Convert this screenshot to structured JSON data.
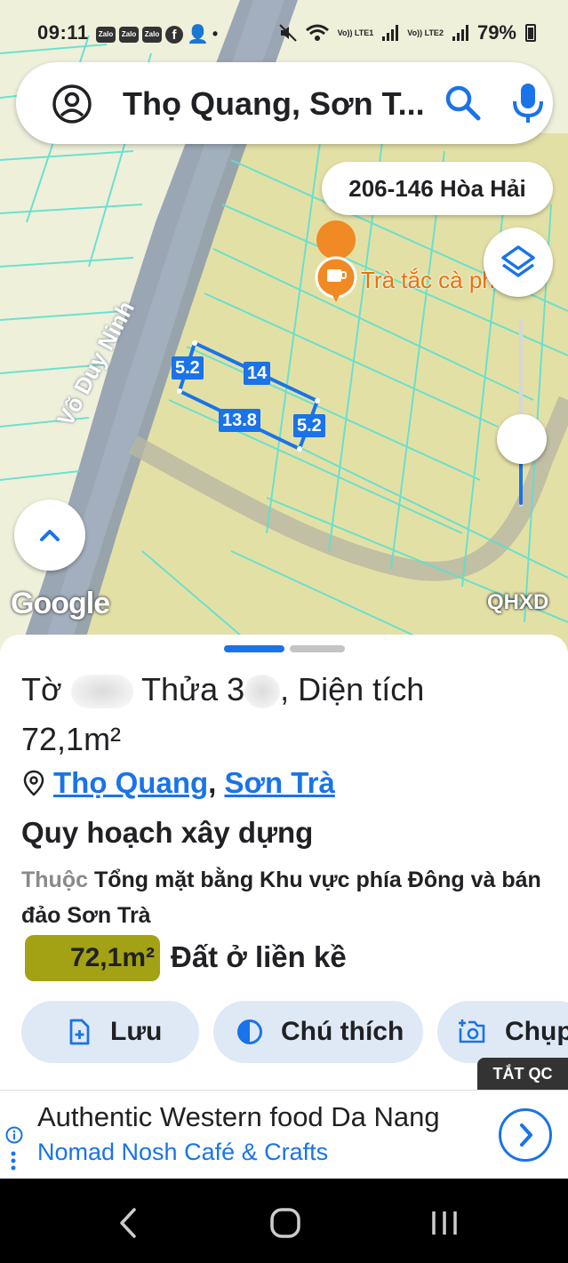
{
  "status_bar": {
    "time": "09:11",
    "notification_labels": [
      "Zalo",
      "Zalo",
      "Zalo"
    ],
    "battery": "79%",
    "sim1": "Vo)) LTE1",
    "sim2": "Vo)) LTE2"
  },
  "search": {
    "query": "Thọ Quang, Sơn T..."
  },
  "map": {
    "address_chip": "206-146 Hòa Hải",
    "poi_label": "Trà tắc cà phê oz",
    "road_label": "Võ Duy Ninh",
    "measurements": {
      "top": "14",
      "left": "5.2",
      "bottom": "13.8",
      "right": "5.2"
    },
    "logo": "Google",
    "layer_label": "QHXD",
    "opacity_level": 0.35
  },
  "sheet": {
    "title_part1": "Tờ",
    "title_part2": "Thửa 3",
    "title_part3": ", Diện tích",
    "title_area": "72,1m²",
    "location": {
      "ward": "Thọ Quang",
      "district": "Sơn Trà"
    },
    "section_heading": "Quy hoạch xây dựng",
    "plan_prefix": "Thuộc",
    "plan_name": "Tổng mặt bằng Khu vực phía Đông và bán đảo Sơn Trà",
    "area_badge": "72,1m²",
    "land_type": "Đất ở liền kề",
    "actions": {
      "save": "Lưu",
      "legend": "Chú thích",
      "capture": "Chụp"
    },
    "ad_off": "TẮT QC"
  },
  "ad": {
    "title": "Authentic Western food Da Nang",
    "subtitle": "Nomad Nosh Café & Crafts"
  },
  "colors": {
    "accent": "#1a73e8",
    "zone_fill": "#e3e0a6",
    "parcel_line": "#5de0d0",
    "area_badge": "#a3a114"
  }
}
